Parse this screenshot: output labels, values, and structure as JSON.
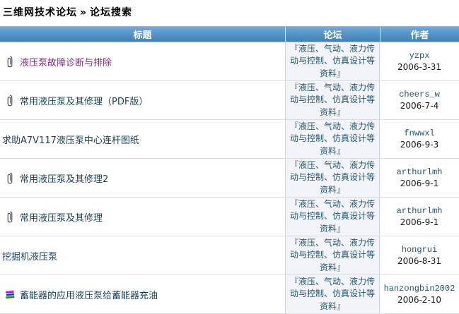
{
  "breadcrumb": {
    "site": "三维网技术论坛",
    "separator": "»",
    "page": "论坛搜索"
  },
  "table": {
    "headers": {
      "title": "标题",
      "forum": "论坛",
      "author": "作者"
    },
    "rows": [
      {
        "icon": "paperclip-icon",
        "visited": true,
        "title": "液压泵故障诊断与排除",
        "forum": "『液压、气动、液力传动与控制、仿真设计等资料』",
        "author": "yzpx",
        "date": "2006-3-31"
      },
      {
        "icon": "paperclip-icon",
        "visited": false,
        "title": "常用液压泵及其修理（PDF版）",
        "forum": "『液压、气动、液力传动与控制、仿真设计等资料』",
        "author": "cheers_w",
        "date": "2006-7-4"
      },
      {
        "icon": null,
        "visited": false,
        "title": "求助A7V117液压泵中心连杆图纸",
        "forum": "『液压、气动、液力传动与控制、仿真设计等资料』",
        "author": "fnwwxl",
        "date": "2006-9-3"
      },
      {
        "icon": "paperclip-icon",
        "visited": false,
        "title": "常用液压泵及其修理2",
        "forum": "『液压、气动、液力传动与控制、仿真设计等资料』",
        "author": "arthurlmh",
        "date": "2006-9-1"
      },
      {
        "icon": "paperclip-icon",
        "visited": false,
        "title": "常用液压泵及其修理",
        "forum": "『液压、气动、液力传动与控制、仿真设计等资料』",
        "author": "arthurlmh",
        "date": "2006-9-1"
      },
      {
        "icon": null,
        "visited": false,
        "title": "挖掘机液压泵",
        "forum": "『液压、气动、液力传动与控制、仿真设计等资料』",
        "author": "hongrui",
        "date": "2006-8-31"
      },
      {
        "icon": "rar-icon",
        "visited": false,
        "title": "蓄能器的应用液压泵给蓄能器充油",
        "forum": "『液压、气动、液力传动与控制、仿真设计等资料』",
        "author": "hanzongbin2002",
        "date": "2006-2-10"
      }
    ]
  },
  "colors": {
    "header_blue": "#4e8fc0",
    "forum_cell_bg": "#f2f4fa",
    "link_dark": "#1c4257",
    "link_visited": "#7d2b7d",
    "forum_link": "#24566b"
  }
}
